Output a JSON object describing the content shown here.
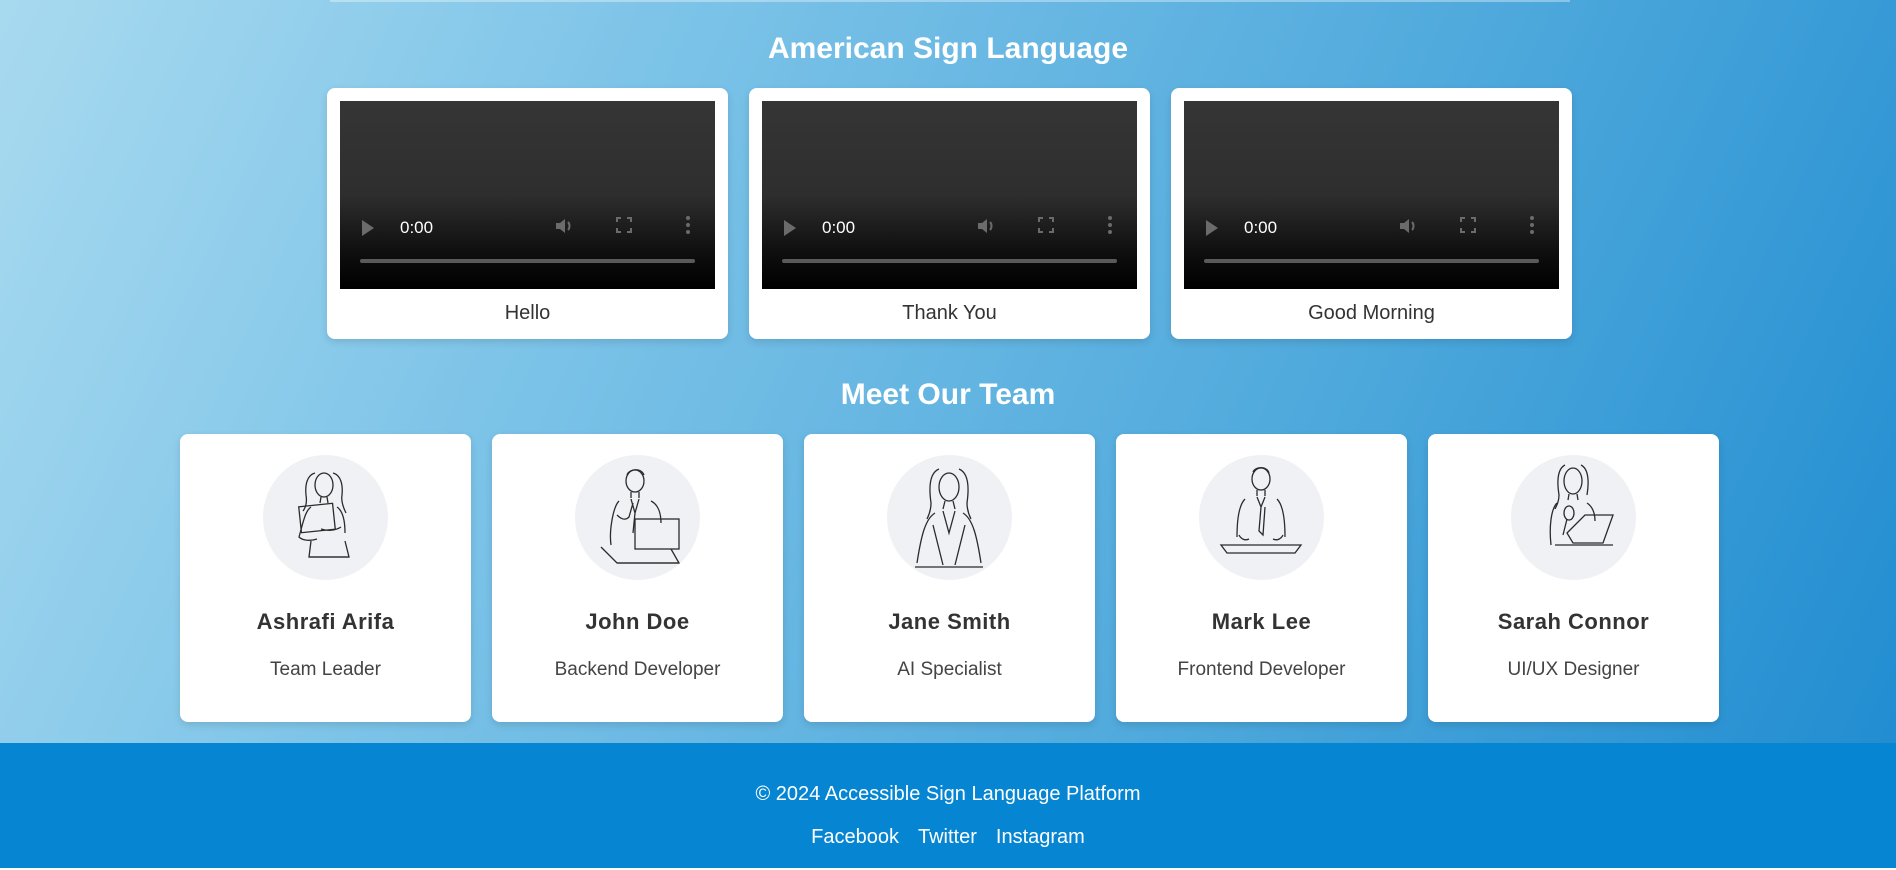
{
  "sign_section": {
    "title": "American Sign Language",
    "videos": [
      {
        "label": "Hello",
        "time": "0:00"
      },
      {
        "label": "Thank You",
        "time": "0:00"
      },
      {
        "label": "Good Morning",
        "time": "0:00"
      }
    ]
  },
  "team_section": {
    "title": "Meet Our Team",
    "members": [
      {
        "name": "Ashrafi Arifa",
        "role": "Team Leader",
        "avatar_icon": "woman-holding-folder-icon"
      },
      {
        "name": "John Doe",
        "role": "Backend Developer",
        "avatar_icon": "man-with-laptop-icon"
      },
      {
        "name": "Jane Smith",
        "role": "AI Specialist",
        "avatar_icon": "woman-in-blazer-icon"
      },
      {
        "name": "Mark Lee",
        "role": "Frontend Developer",
        "avatar_icon": "man-at-desk-icon"
      },
      {
        "name": "Sarah Connor",
        "role": "UI/UX Designer",
        "avatar_icon": "woman-with-laptop-icon"
      }
    ]
  },
  "footer": {
    "copyright": "© 2024 Accessible Sign Language Platform",
    "links": [
      "Facebook",
      "Twitter",
      "Instagram"
    ]
  },
  "colors": {
    "footer_bg": "#0585d2",
    "gradient_start": "#a8daef",
    "gradient_end": "#1e8bd0"
  }
}
